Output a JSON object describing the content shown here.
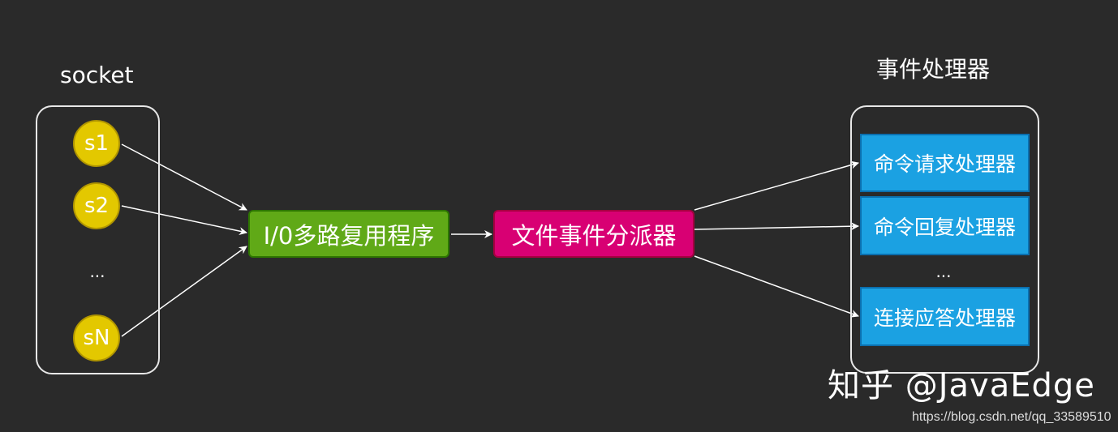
{
  "socket_group": {
    "title": "socket",
    "items": [
      "s1",
      "s2",
      "sN"
    ],
    "ellipsis": "..."
  },
  "multiplexer": {
    "label": "I/0多路复用程序"
  },
  "dispatcher": {
    "label": "文件事件分派器"
  },
  "handler_group": {
    "title": "事件处理器",
    "items": [
      "命令请求处理器",
      "命令回复处理器",
      "连接应答处理器"
    ],
    "ellipsis": "..."
  },
  "watermark": {
    "text": "知乎 @JavaEdge",
    "url": "https://blog.csdn.net/qq_33589510"
  },
  "colors": {
    "background": "#2a2a2a",
    "socket_fill": "#e3c800",
    "multiplexer_fill": "#60a917",
    "dispatcher_fill": "#d80073",
    "handler_fill": "#1ba1e2",
    "arrow": "#ffffff"
  }
}
